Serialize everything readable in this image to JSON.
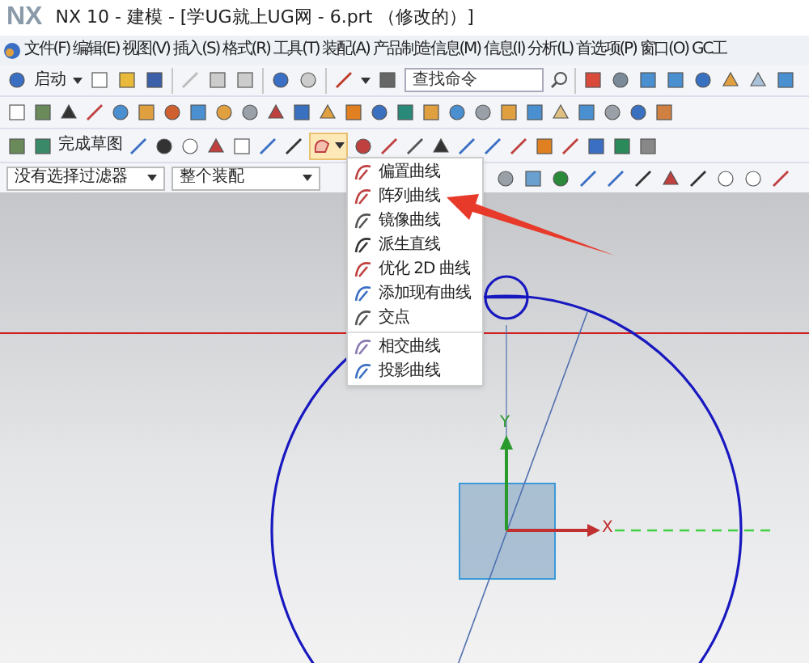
{
  "window": {
    "logo": "NX",
    "title": "NX 10 - 建模 - [学UG就上UG网 - 6.prt （修改的）]"
  },
  "menu_bar": [
    "文件(F)",
    "编辑(E)",
    "视图(V)",
    "插入(S)",
    "格式(R)",
    "工具(T)",
    "装配(A)",
    "产品制造信息(M)",
    "信息(I)",
    "分析(L)",
    "首选项(P)",
    "窗口(O)",
    "GC工"
  ],
  "toolbar": {
    "start_button": "启动",
    "search": {
      "placeholder": "查找命令"
    }
  },
  "sketch_toolbar": {
    "finish_button": "完成草图"
  },
  "selection_bar": {
    "filter": "没有选择过滤器",
    "scope": "整个装配"
  },
  "dropdown_menu": {
    "items": [
      {
        "label": "偏置曲线",
        "separator_before": false
      },
      {
        "label": "阵列曲线",
        "separator_before": false
      },
      {
        "label": "镜像曲线",
        "separator_before": false
      },
      {
        "label": "派生直线",
        "separator_before": false
      },
      {
        "label": "优化 2D 曲线",
        "separator_before": false
      },
      {
        "label": "添加现有曲线",
        "separator_before": false
      },
      {
        "label": "交点",
        "separator_before": false
      },
      {
        "label": "相交曲线",
        "separator_before": true
      },
      {
        "label": "投影曲线",
        "separator_before": false
      }
    ]
  },
  "canvas": {
    "x_axis_label": "X",
    "y_axis_label": "Y"
  }
}
